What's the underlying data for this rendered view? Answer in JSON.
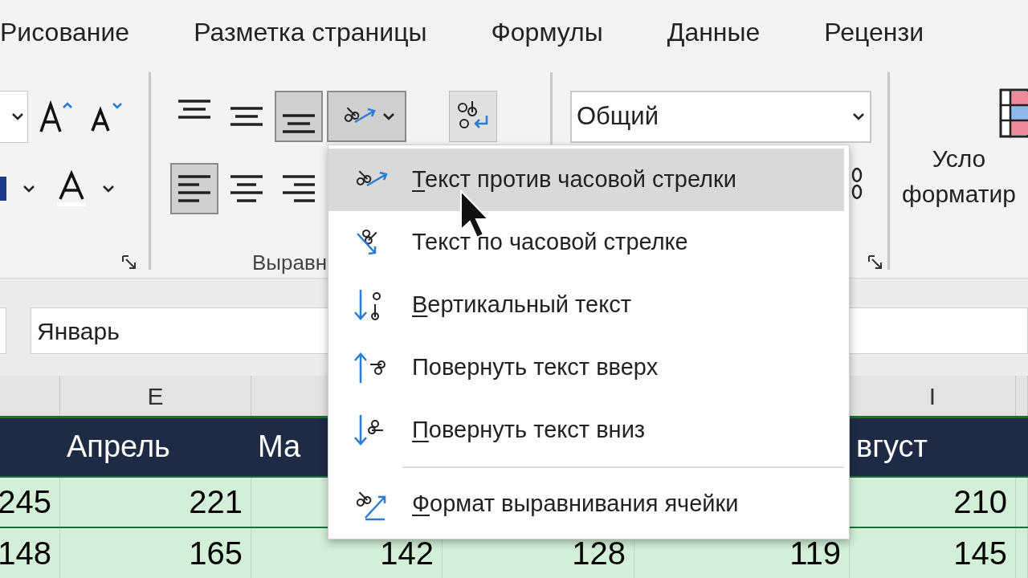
{
  "ribbon_tabs": [
    {
      "label": "Рисование"
    },
    {
      "label": "Разметка страницы"
    },
    {
      "label": "Формулы"
    },
    {
      "label": "Данные"
    },
    {
      "label": "Рецензи"
    }
  ],
  "alignment_top": [
    {
      "kind": "top",
      "selected": false
    },
    {
      "kind": "middle",
      "selected": false
    },
    {
      "kind": "bottom",
      "selected": true
    }
  ],
  "orientation_button": {
    "pressed": true
  },
  "alignment_bottom": [
    {
      "kind": "left",
      "selected": true
    },
    {
      "kind": "center",
      "selected": false
    },
    {
      "kind": "right",
      "selected": false
    }
  ],
  "alignment_group_label": "Выравн",
  "number_format": {
    "value": "Общий"
  },
  "styles_group": {
    "label_lines": [
      "Усло",
      "форматир"
    ]
  },
  "formula_bar": {
    "value": "Январь"
  },
  "column_headers": [
    {
      "kind": "empty"
    },
    {
      "kind": "letter",
      "text": "E"
    },
    {
      "kind": "empty"
    },
    {
      "kind": "empty"
    },
    {
      "kind": "empty"
    },
    {
      "kind": "letter",
      "text": "I"
    },
    {
      "kind": "empty"
    }
  ],
  "table": {
    "header": [
      {
        "kind": "empty"
      },
      {
        "kind": "text",
        "text": "Апрель"
      },
      {
        "kind": "text",
        "text": "Ма"
      },
      {
        "kind": "empty"
      },
      {
        "kind": "empty"
      },
      {
        "kind": "text",
        "text": "вгуст"
      },
      {
        "kind": "empty"
      }
    ],
    "rows": [
      [
        {
          "kind": "value",
          "text": "245"
        },
        {
          "kind": "value",
          "text": "221"
        },
        {
          "kind": "empty"
        },
        {
          "kind": "empty"
        },
        {
          "kind": "empty"
        },
        {
          "kind": "value",
          "text": "210"
        },
        {
          "kind": "empty"
        }
      ],
      [
        {
          "kind": "value",
          "text": "148"
        },
        {
          "kind": "value",
          "text": "165"
        },
        {
          "kind": "value",
          "text": "142"
        },
        {
          "kind": "value",
          "text": "128"
        },
        {
          "kind": "value",
          "text": "119"
        },
        {
          "kind": "value",
          "text": "145"
        },
        {
          "kind": "empty"
        }
      ]
    ]
  },
  "orientation_menu": {
    "items": [
      {
        "kind": "ccw",
        "key": "Т",
        "rest": "екст против часовой стрелки",
        "selected": true
      },
      {
        "kind": "cw",
        "label": "Текст по часовой стрелке",
        "selected": false
      },
      {
        "kind": "vertical",
        "key": "В",
        "rest": "ертикальный текст",
        "selected": false
      },
      {
        "kind": "up",
        "label": "Повернуть текст вверх",
        "selected": false
      },
      {
        "kind": "down",
        "key": "П",
        "rest": "овернуть текст вниз",
        "selected": false
      },
      {
        "kind": "separator"
      },
      {
        "kind": "format",
        "key": "Ф",
        "rest": "ормат выравнивания ячейки",
        "selected": false
      }
    ]
  }
}
